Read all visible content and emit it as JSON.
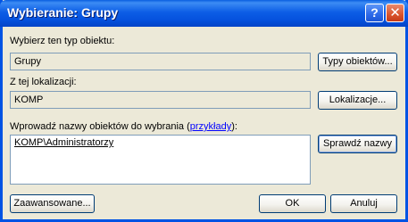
{
  "window": {
    "title": "Wybieranie: Grupy",
    "help_label": "?",
    "close_label": "✕"
  },
  "object_type": {
    "label": "Wybierz ten typ obiektu:",
    "value": "Grupy",
    "button": "Typy obiektów..."
  },
  "location": {
    "label": "Z tej lokalizacji:",
    "value": "KOMP",
    "button": "Lokalizacje..."
  },
  "names": {
    "label_prefix": "Wprowadź nazwy obiektów do wybrania (",
    "examples_link": "przykłady",
    "label_suffix": "):",
    "value": "KOMP\\Administratorzy",
    "check_button": "Sprawdź nazwy"
  },
  "footer": {
    "advanced_button": "Zaawansowane...",
    "ok_button": "OK",
    "cancel_button": "Anuluj"
  }
}
